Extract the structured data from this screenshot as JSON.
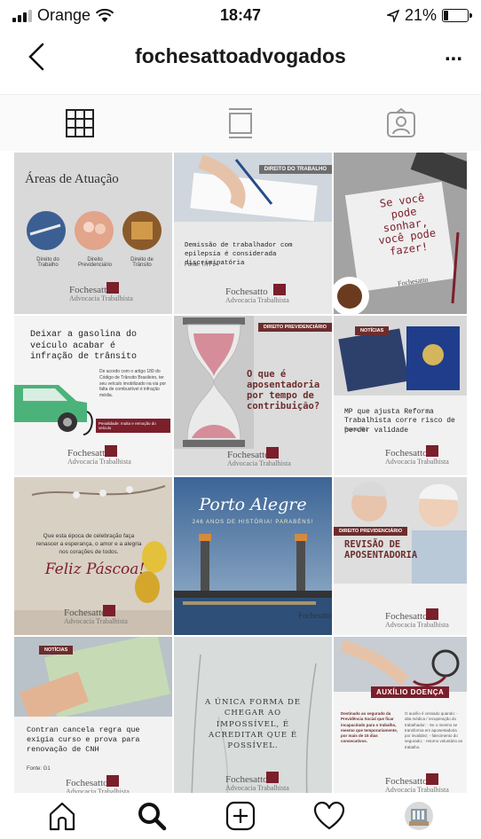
{
  "status": {
    "carrier": "Orange",
    "time": "18:47",
    "battery": "21%",
    "battery_level": 0.21
  },
  "header": {
    "username": "fochesattoadvogados",
    "more": "..."
  },
  "tabs": [
    "grid",
    "feed",
    "tagged"
  ],
  "brand": {
    "name": "Fochesatto",
    "sub": "Advocacia Trabalhista"
  },
  "posts": [
    {
      "title": "Áreas de Atuação",
      "labels": [
        "Direito do Trabalho",
        "Direito Previdenciário",
        "Direito de Trânsito"
      ]
    },
    {
      "tag": "DIREITO DO TRABALHO",
      "headline": "Demissão de trabalhador com epilepsia é considerada discriminatória",
      "source": "Fonte: TRT 24"
    },
    {
      "quote": [
        "Se você",
        "pode",
        "sonhar,",
        "você pode",
        "fazer!"
      ]
    },
    {
      "headline": "Deixar a gasolina do veículo acabar é infração de trânsito",
      "body": "De acordo com o artigo 180 do Código de Trânsito Brasileiro, ter seu veículo imobilizado na via por falta de combustível é infração média.",
      "note": "Penalidade: multa e remoção do veículo"
    },
    {
      "tag": "DIREITO PREVIDENCIÁRIO",
      "headline": "O que é aposentadoria por tempo de contribuição?"
    },
    {
      "tag": "NOTÍCIAS",
      "headline": "MP que ajusta Reforma Trabalhista corre risco de perder validade",
      "source": "Fonte: G1"
    },
    {
      "message": "Que esta época de celebração faça renascer a esperança, o amor e a alegria nos corações de todos.",
      "greeting": "Feliz Páscoa!"
    },
    {
      "title": "Porto Alegre",
      "subtitle": "246 ANOS DE HISTÓRIA! PARABÉNS!"
    },
    {
      "tag": "DIREITO PREVIDENCIÁRIO",
      "headline": "REVISÃO DE APOSENTADORIA"
    },
    {
      "tag": "NOTÍCIAS",
      "headline": "Contran cancela regra que exigia curso e prova para renovação de CNH",
      "source": "Fonte: G1"
    },
    {
      "quote": "A ÚNICA FORMA DE CHEGAR AO IMPOSSÍVEL, É ACREDITAR QUE É POSSÍVEL."
    },
    {
      "tag": "AUXÍLIO DOENÇA",
      "left": "Destinado ao segurado da Previdência Social que ficar incapacitado para o trabalho, mesmo que temporariamente, por mais de 15 dias consecutivos.",
      "right": "O auxílio é cessado quando: - alta médica / recuperação do trabalhador; - Se o mesmo se transforma em aposentadoria por invalidez; - falecimento do segurado; - retorno voluntário ao trabalho."
    }
  ],
  "bottom_nav": [
    "home",
    "search",
    "new-post",
    "activity",
    "profile"
  ],
  "colors": {
    "brand": "#7b1f2b",
    "text": "#111111",
    "tab_bg": "#fafafa"
  }
}
